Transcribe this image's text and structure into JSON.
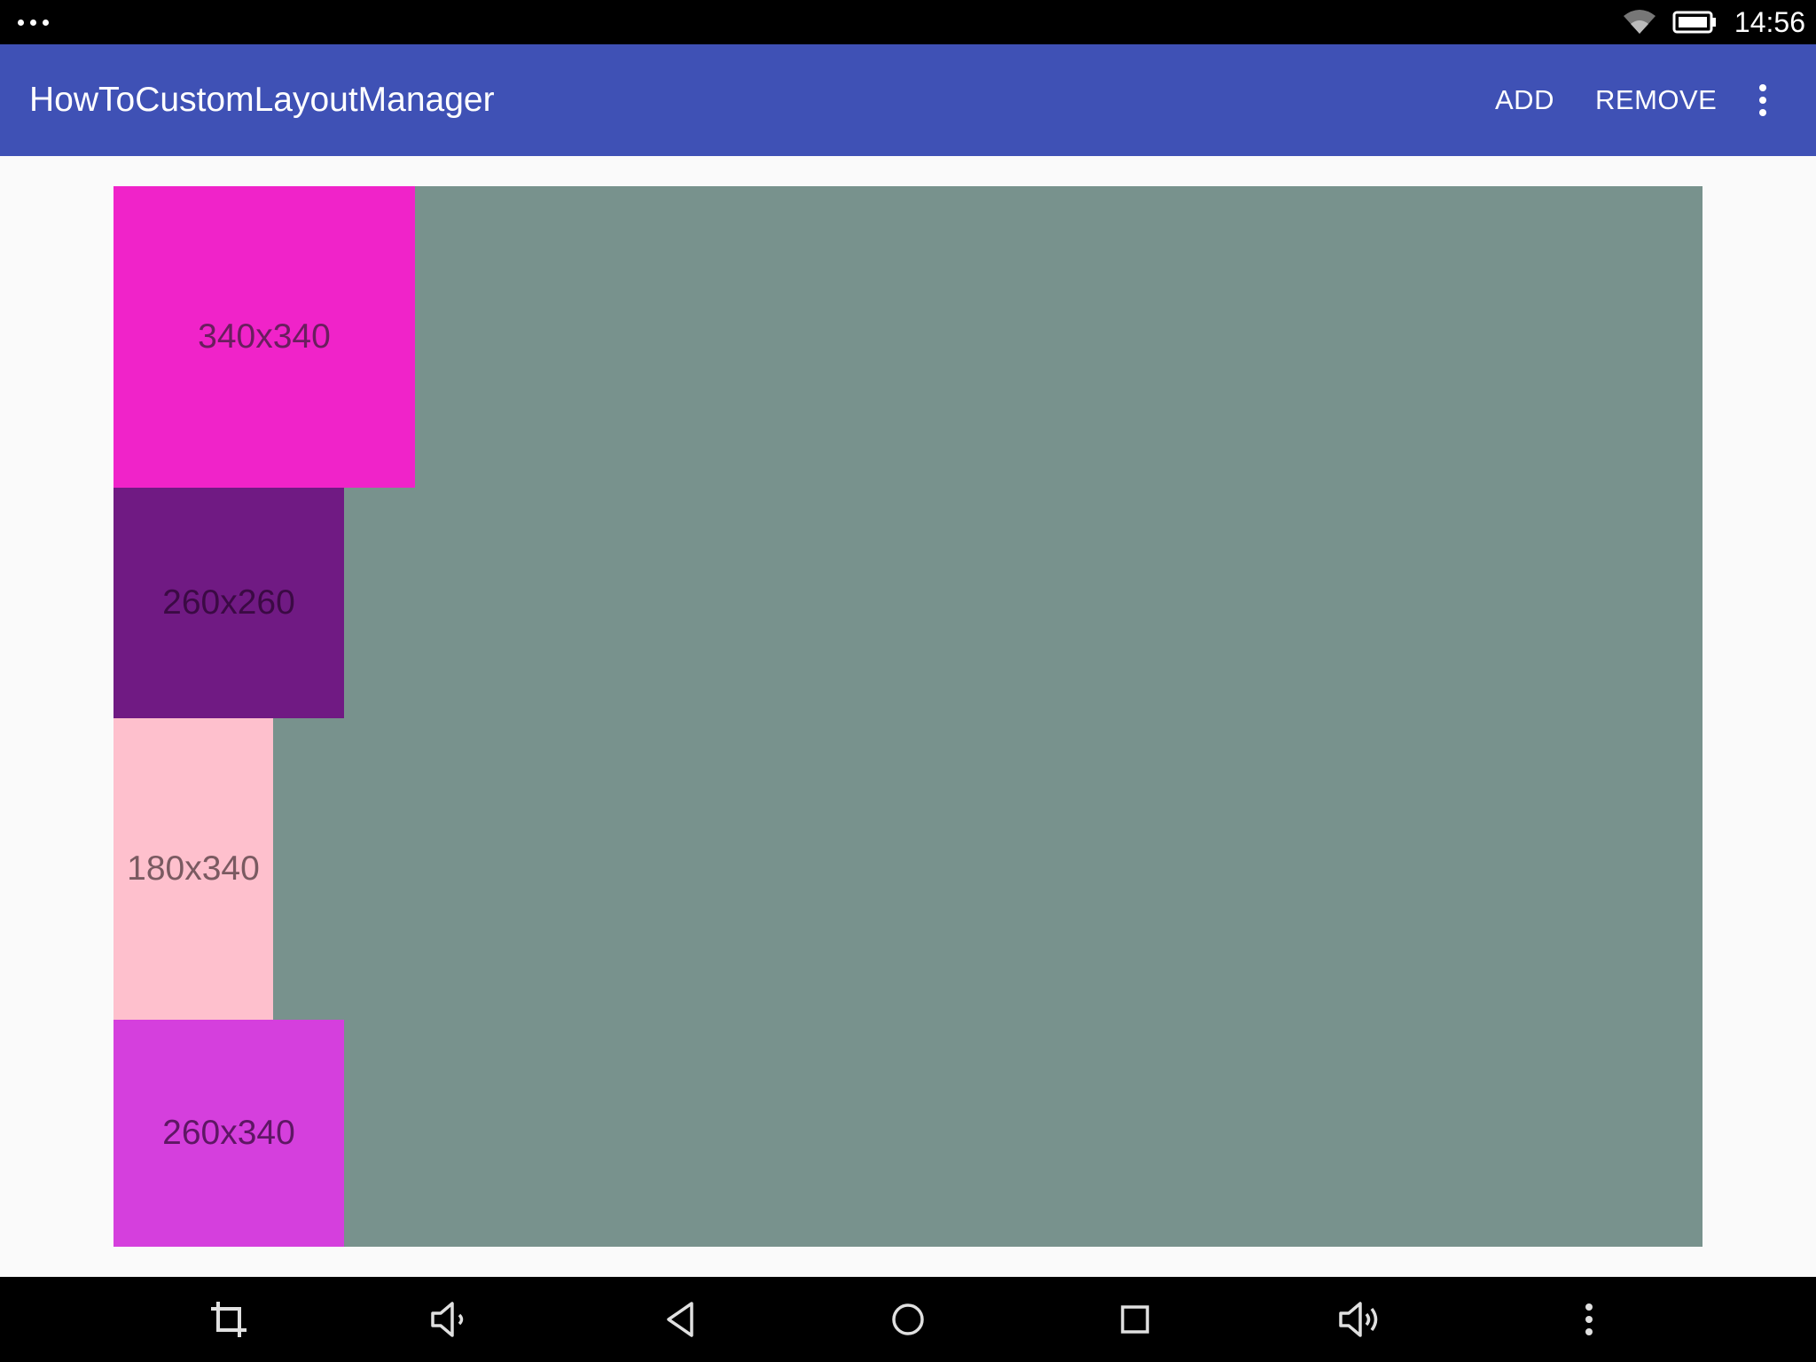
{
  "status_bar": {
    "time": "14:56",
    "icons": [
      "more-dots-icon",
      "wifi-icon",
      "battery-icon"
    ]
  },
  "app_bar": {
    "title": "HowToCustomLayoutManager",
    "actions": [
      "ADD",
      "REMOVE"
    ],
    "overflow_icon": "overflow-menu-icon",
    "color": "#3f51b5"
  },
  "recycler": {
    "background": "#78928d",
    "items": [
      {
        "label": "340x340",
        "color": "#f023c9",
        "text_color": "#6a1e5e"
      },
      {
        "label": "260x260",
        "color": "#701a83",
        "text_color": "#3b0a44"
      },
      {
        "label": "180x340",
        "color": "#fec0cd",
        "text_color": "#7a5a61"
      },
      {
        "label": "260x340",
        "color": "#d53fdd",
        "text_color": "#5e1764"
      }
    ]
  },
  "nav_bar": {
    "buttons": [
      "screenshot-crop-icon",
      "volume-down-icon",
      "back-icon",
      "home-icon",
      "recents-icon",
      "volume-up-icon",
      "menu-icon"
    ]
  }
}
